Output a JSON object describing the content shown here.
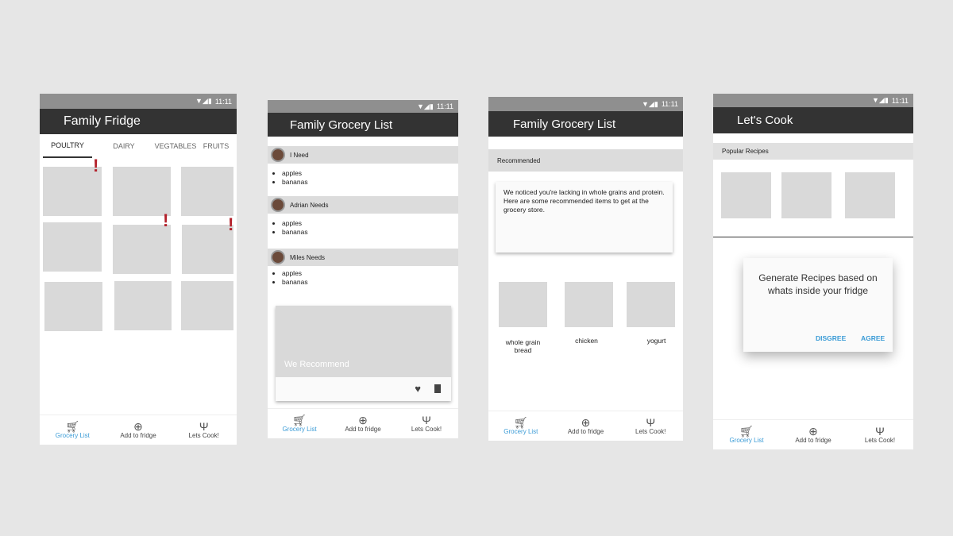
{
  "status_time": "11:11",
  "nav": {
    "grocery": "Grocery List",
    "add": "Add to fridge",
    "cook": "Lets Cook!"
  },
  "screen1": {
    "title": "Family Fridge",
    "tabs": [
      "POULTRY",
      "DAIRY",
      "VEGTABLES",
      "FRUITS"
    ],
    "alert_symbol": "!"
  },
  "screen2": {
    "title": "Family Grocery List",
    "sections": [
      {
        "name": "I Need",
        "items": [
          "apples",
          "bananas"
        ]
      },
      {
        "name": "Adrian  Needs",
        "items": [
          "apples",
          "bananas"
        ]
      },
      {
        "name": "Miles Needs",
        "items": [
          "apples",
          "bananas"
        ]
      }
    ],
    "recommend_label": "We Recommend"
  },
  "screen3": {
    "title": "Family Grocery List",
    "section": "Recommended",
    "message": "We noticed you're lacking in whole grains and protein. Here are some recommended items to get at the grocery store.",
    "items": [
      "whole grain bread",
      "chicken",
      "yogurt"
    ]
  },
  "screen4": {
    "title": "Let's Cook",
    "section": "Popular Recipes",
    "dialog": {
      "text": "Generate Recipes based on whats inside your fridge",
      "disagree": "DISGREE",
      "agree": "AGREE"
    }
  },
  "colors": {
    "accent": "#3a9bd6",
    "alert": "#b3202a",
    "appbar": "#333333"
  }
}
